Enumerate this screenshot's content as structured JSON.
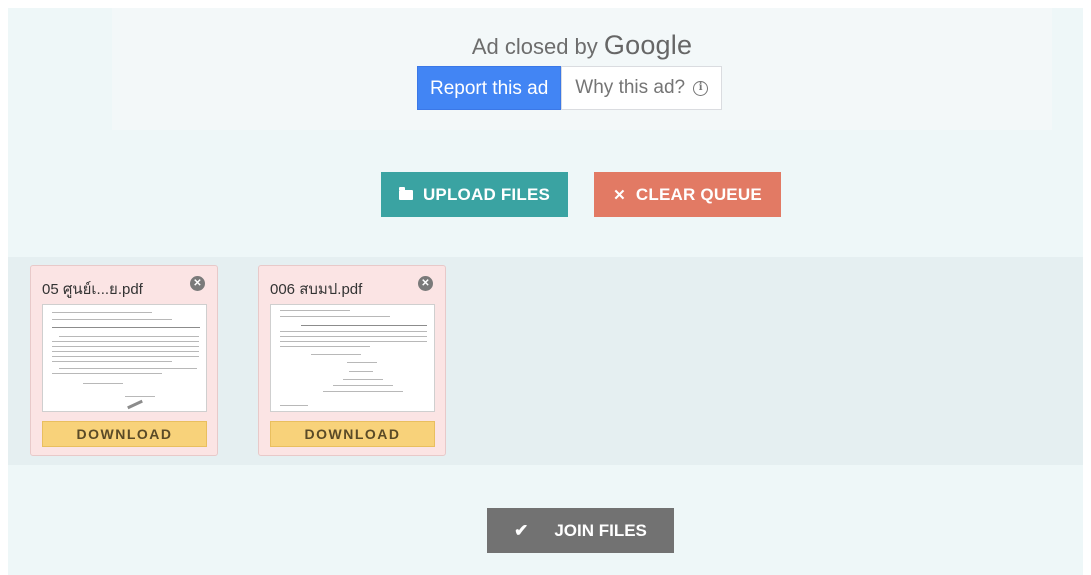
{
  "ad": {
    "closed_prefix": "Ad closed by",
    "brand": "Google",
    "report_label": "Report this ad",
    "why_label": "Why this ad?",
    "info_glyph": "i"
  },
  "actions": {
    "upload_label": "UPLOAD FILES",
    "clear_label": "CLEAR QUEUE",
    "join_label": "JOIN FILES"
  },
  "files": [
    {
      "name": "05 ศูนย์เ...ย.pdf",
      "download_label": "DOWNLOAD"
    },
    {
      "name": "006 สบมป.pdf",
      "download_label": "DOWNLOAD"
    }
  ],
  "icons": {
    "upload": "folder-open-icon",
    "clear": "times-icon",
    "join": "check-icon",
    "remove": "close-circle-icon",
    "info": "info-icon"
  },
  "colors": {
    "google_blue": "#4285f4",
    "upload_teal": "#3aa3a2",
    "clear_coral": "#e27a64",
    "join_gray": "#727272",
    "download_yellow": "#f8d27a",
    "card_pink": "#fbe4e4"
  }
}
